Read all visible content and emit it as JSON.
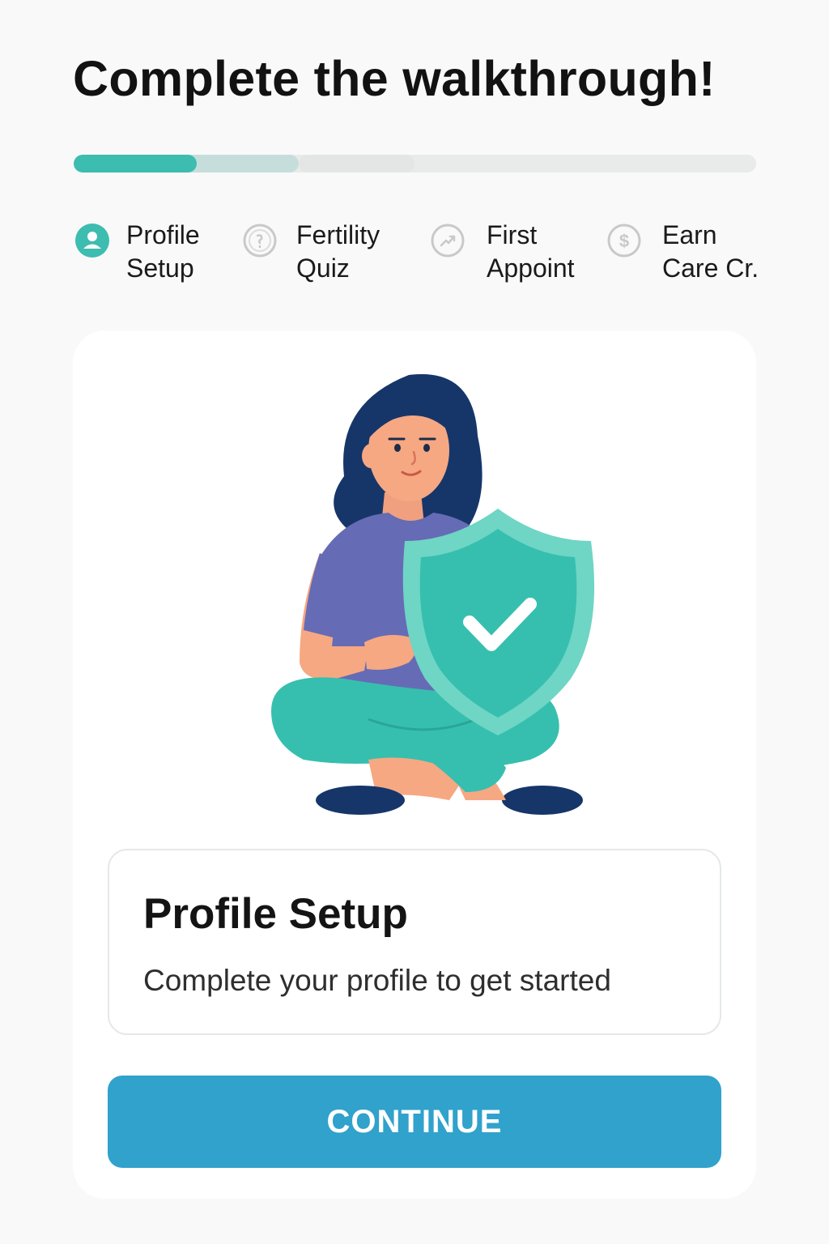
{
  "header": {
    "title": "Complete the walkthrough!"
  },
  "progress": {
    "fraction": 0.18,
    "accent": "#3dbcb0",
    "track": "#e9ebeb"
  },
  "steps": [
    {
      "label": "Profile\nSetup",
      "icon": "user-icon",
      "active": true
    },
    {
      "label": "Fertility\nQuiz",
      "icon": "question-coin-icon",
      "active": false
    },
    {
      "label": "First\nAppoint",
      "icon": "trend-arrow-icon",
      "active": false
    },
    {
      "label": "Earn\nCare Cr.",
      "icon": "dollar-icon",
      "active": false
    }
  ],
  "card": {
    "illustration": "woman-with-shield-checkmark",
    "title": "Profile Setup",
    "subtitle": "Complete your profile to get started",
    "button_label": "CONTINUE"
  },
  "colors": {
    "accent": "#3dbcb0",
    "button": "#30a2cc",
    "inactive_icon": "#c9c9c9"
  }
}
